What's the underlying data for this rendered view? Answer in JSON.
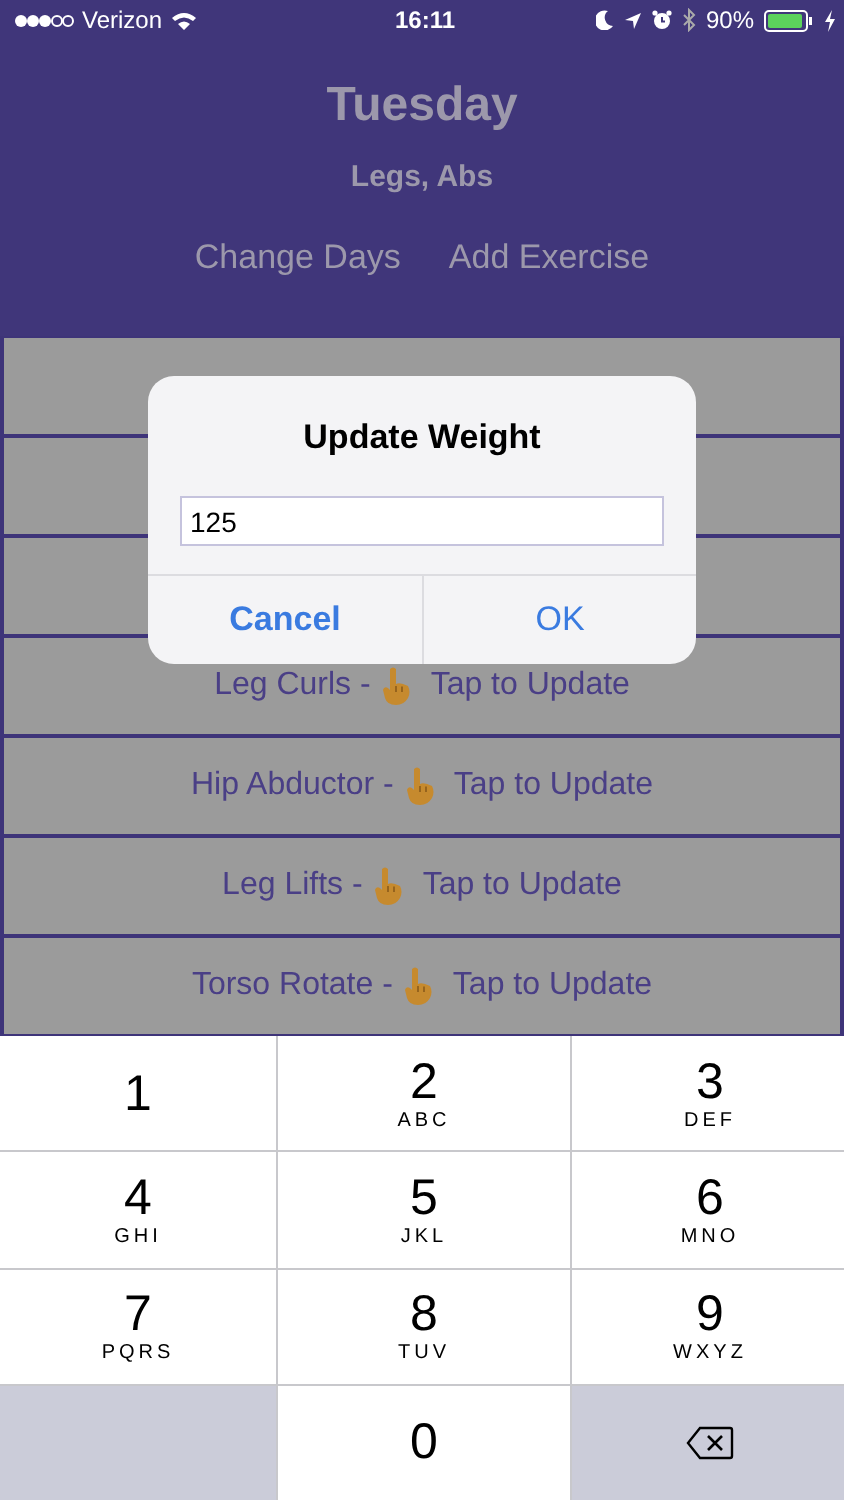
{
  "status_bar": {
    "carrier": "Verizon",
    "time": "16:11",
    "battery": "90%"
  },
  "header": {
    "title": "Tuesday",
    "subtitle": "Legs, Abs",
    "actions": [
      "Change Days",
      "Add Exercise"
    ]
  },
  "exercises": [
    {
      "name": "Leg Curls -",
      "action": "Tap to Update"
    },
    {
      "name": "Hip Abductor -",
      "action": "Tap to Update"
    },
    {
      "name": "Leg Lifts -",
      "action": "Tap to Update"
    },
    {
      "name": "Torso Rotate -",
      "action": "Tap to Update"
    }
  ],
  "dialog": {
    "title": "Update Weight",
    "value": "125",
    "buttons": [
      {
        "label": "Cancel",
        "kind": "cancel"
      },
      {
        "label": "OK",
        "kind": "default"
      }
    ]
  },
  "keypad": [
    {
      "kind": "digit",
      "digit": "1"
    },
    {
      "kind": "digit",
      "digit": "2",
      "letters": "ABC"
    },
    {
      "kind": "digit",
      "digit": "3",
      "letters": "DEF"
    },
    {
      "kind": "digit",
      "digit": "4",
      "letters": "GHI"
    },
    {
      "kind": "digit",
      "digit": "5",
      "letters": "JKL"
    },
    {
      "kind": "digit",
      "digit": "6",
      "letters": "MNO"
    },
    {
      "kind": "digit",
      "digit": "7",
      "letters": "PQRS"
    },
    {
      "kind": "digit",
      "digit": "8",
      "letters": "TUV"
    },
    {
      "kind": "digit",
      "digit": "9",
      "letters": "WXYZ"
    },
    {
      "kind": "blank"
    },
    {
      "kind": "digit",
      "digit": "0"
    },
    {
      "kind": "delete"
    }
  ]
}
